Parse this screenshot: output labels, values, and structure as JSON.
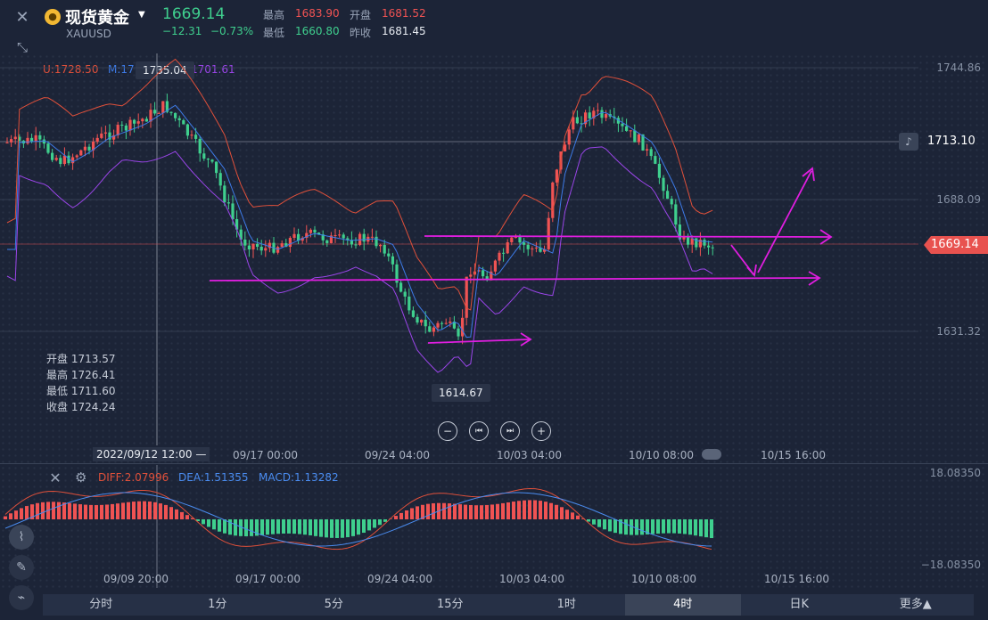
{
  "header": {
    "symbol_name": "现货黄金",
    "symbol_code": "XAUUSD",
    "price": "1669.14",
    "change": "−12.31",
    "change_pct": "−0.73%",
    "high_label": "最高",
    "high": "1683.90",
    "open_label": "开盘",
    "open": "1681.52",
    "low_label": "最低",
    "low": "1660.80",
    "prev_label": "昨收",
    "prev": "1681.45"
  },
  "bands": {
    "upper": "U:1728.50",
    "mid": "M:171",
    "lower": "1701.61",
    "tooltip": "1735.04"
  },
  "y_axis": {
    "ticks": [
      "1744.86",
      "1688.09",
      "1631.32"
    ],
    "alert_price": "1713.10",
    "current_price": "1669.14"
  },
  "cursor_ohlc": [
    {
      "label": "开盘",
      "value": "1713.57"
    },
    {
      "label": "最高",
      "value": "1726.41"
    },
    {
      "label": "最低",
      "value": "1711.60"
    },
    {
      "label": "收盘",
      "value": "1724.24"
    }
  ],
  "low_marker": "1614.67",
  "x_axis": {
    "cursor_label": "2022/09/12 12:00",
    "ticks": [
      "09/17 00:00",
      "09/24 04:00",
      "10/03 04:00",
      "10/10 08:00",
      "10/15 16:00"
    ]
  },
  "macd": {
    "diff": "DIFF:2.07996",
    "dea": "DEA:1.51355",
    "macd": "MACD:1.13282",
    "top": "18.08350",
    "bottom": "−18.08350",
    "x_ticks": [
      "09/09 20:00",
      "09/17 00:00",
      "09/24 04:00",
      "10/03 04:00",
      "10/10 08:00",
      "10/15 16:00"
    ]
  },
  "tabs": [
    "分时",
    "1分",
    "5分",
    "15分",
    "1时",
    "4时",
    "日K",
    "更多"
  ],
  "active_tab": "4时",
  "colors": {
    "up": "#f05353",
    "down": "#3fcf8e",
    "annotation": "#e01ee0",
    "upper_band": "#e0503a",
    "mid_band": "#3d7be8",
    "lower_band": "#9a45e8",
    "dea": "#4a8cf0"
  },
  "chart_data": {
    "type": "candlestick",
    "series_count": 96,
    "start_price": 1712,
    "price_range": [
      1604,
      1750
    ]
  }
}
